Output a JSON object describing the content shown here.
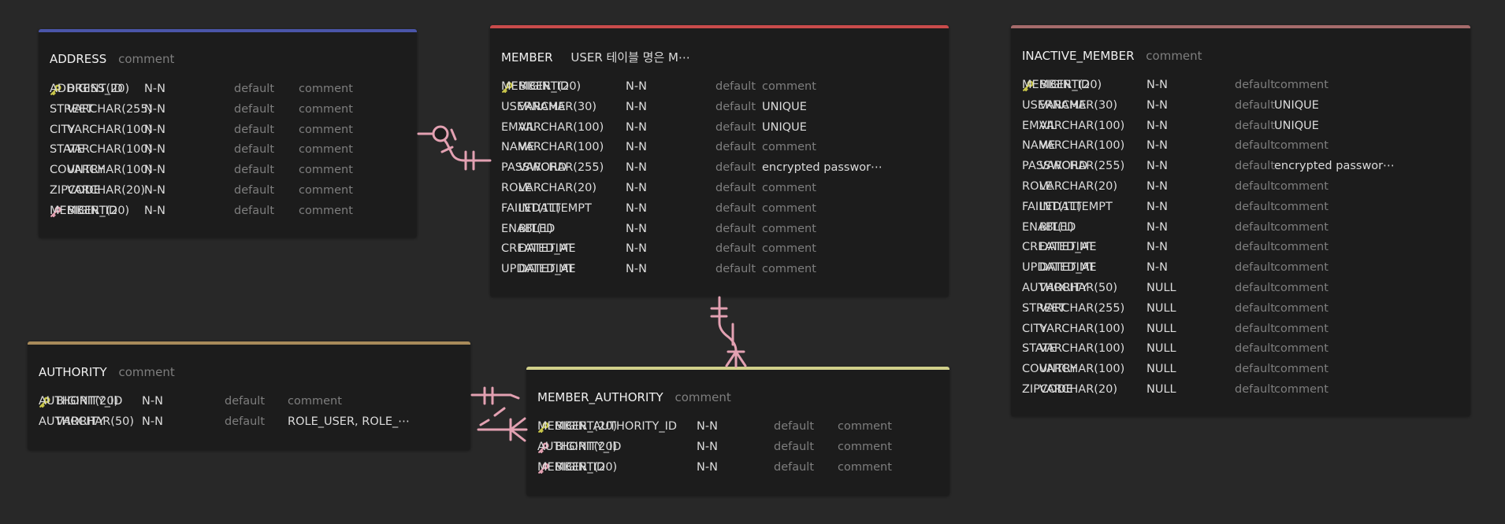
{
  "colors": {
    "background": "#282828",
    "table_bg": "#1c1c1c",
    "relationship": "#e3a1b2",
    "primary_key": "#c9c64a",
    "foreign_key": "#e3a1b2",
    "muted_text": "#7e7e7e"
  },
  "tables": {
    "address": {
      "name": "ADDRESS",
      "comment": "comment",
      "color": "#4a55a8",
      "columns": [
        {
          "name": "ADDRESS_ID",
          "type": "BIGINT(20)",
          "nullable": "N-N",
          "default": "default",
          "comment": "comment",
          "key": "key-icon"
        },
        {
          "name": "STREET",
          "type": "VARCHAR(255)",
          "nullable": "N-N",
          "default": "default",
          "comment": "comment"
        },
        {
          "name": "CITY",
          "type": "VARCHAR(100)",
          "nullable": "N-N",
          "default": "default",
          "comment": "comment"
        },
        {
          "name": "STATE",
          "type": "VARCHAR(100)",
          "nullable": "N-N",
          "default": "default",
          "comment": "comment"
        },
        {
          "name": "COUNTRY",
          "type": "VARCHAR(100)",
          "nullable": "N-N",
          "default": "default",
          "comment": "comment"
        },
        {
          "name": "ZIPCODE",
          "type": "VARCHAR(20)",
          "nullable": "N-N",
          "default": "default",
          "comment": "comment"
        },
        {
          "name": "MEMBER_ID",
          "type": "BIGINT(20)",
          "nullable": "N-N",
          "default": "default",
          "comment": "comment",
          "key": "foreign-key-icon"
        }
      ]
    },
    "member": {
      "name": "MEMBER",
      "comment": "USER 테이블 명은 M⋯",
      "color": "#c94b4b",
      "columns": [
        {
          "name": "MEMBER_ID",
          "type": "BIGINT(20)",
          "nullable": "N-N",
          "default": "default",
          "comment": "comment",
          "key": "key-icon"
        },
        {
          "name": "USERNAME",
          "type": "VARCHAR(30)",
          "nullable": "N-N",
          "default": "default",
          "comment": "UNIQUE"
        },
        {
          "name": "EMAIL",
          "type": "VARCHAR(100)",
          "nullable": "N-N",
          "default": "default",
          "comment": "UNIQUE"
        },
        {
          "name": "NAME",
          "type": "VARCHAR(100)",
          "nullable": "N-N",
          "default": "default",
          "comment": "comment"
        },
        {
          "name": "PASSWORD",
          "type": "VARCHAR(255)",
          "nullable": "N-N",
          "default": "default",
          "comment": "encrypted passwor⋯"
        },
        {
          "name": "ROLE",
          "type": "VARCHAR(20)",
          "nullable": "N-N",
          "default": "default",
          "comment": "comment"
        },
        {
          "name": "FAILEDATTEMPT",
          "type": "INT(11)",
          "nullable": "N-N",
          "default": "default",
          "comment": "comment"
        },
        {
          "name": "ENABLED",
          "type": "BIT(1)",
          "nullable": "N-N",
          "default": "default",
          "comment": "comment"
        },
        {
          "name": "CREATED_AT",
          "type": "DATETIME",
          "nullable": "N-N",
          "default": "default",
          "comment": "comment"
        },
        {
          "name": "UPDATED_AT",
          "type": "DATETIME",
          "nullable": "N-N",
          "default": "default",
          "comment": "comment"
        }
      ]
    },
    "inactive_member": {
      "name": "INACTIVE_MEMBER",
      "comment": "comment",
      "color": "#a56b6b",
      "columns": [
        {
          "name": "MEMBER_ID",
          "type": "BIGINT(20)",
          "nullable": "N-N",
          "default": "default",
          "comment": "comment",
          "key": "key-icon"
        },
        {
          "name": "USERNAME",
          "type": "VARCHAR(30)",
          "nullable": "N-N",
          "default": "default",
          "comment": "UNIQUE"
        },
        {
          "name": "EMAIL",
          "type": "VARCHAR(100)",
          "nullable": "N-N",
          "default": "default",
          "comment": "UNIQUE"
        },
        {
          "name": "NAME",
          "type": "VARCHAR(100)",
          "nullable": "N-N",
          "default": "default",
          "comment": "comment"
        },
        {
          "name": "PASSWORD",
          "type": "VARCHAR(255)",
          "nullable": "N-N",
          "default": "default",
          "comment": "encrypted passwor⋯"
        },
        {
          "name": "ROLE",
          "type": "VARCHAR(20)",
          "nullable": "N-N",
          "default": "default",
          "comment": "comment"
        },
        {
          "name": "FAILEDATTEMPT",
          "type": "INT(11)",
          "nullable": "N-N",
          "default": "default",
          "comment": "comment"
        },
        {
          "name": "ENABLED",
          "type": "BIT(1)",
          "nullable": "N-N",
          "default": "default",
          "comment": "comment"
        },
        {
          "name": "CREATED_AT",
          "type": "DATETIME",
          "nullable": "N-N",
          "default": "default",
          "comment": "comment"
        },
        {
          "name": "UPDATED_AT",
          "type": "DATETIME",
          "nullable": "N-N",
          "default": "default",
          "comment": "comment"
        },
        {
          "name": "AUTHORITY",
          "type": "VARCHAR(50)",
          "nullable": "NULL",
          "default": "default",
          "comment": "comment"
        },
        {
          "name": "STREET",
          "type": "VARCHAR(255)",
          "nullable": "NULL",
          "default": "default",
          "comment": "comment"
        },
        {
          "name": "CITY",
          "type": "VARCHAR(100)",
          "nullable": "NULL",
          "default": "default",
          "comment": "comment"
        },
        {
          "name": "STATE",
          "type": "VARCHAR(100)",
          "nullable": "NULL",
          "default": "default",
          "comment": "comment"
        },
        {
          "name": "COUNTRY",
          "type": "VARCHAR(100)",
          "nullable": "NULL",
          "default": "default",
          "comment": "comment"
        },
        {
          "name": "ZIPCODE",
          "type": "VARCHAR(20)",
          "nullable": "NULL",
          "default": "default",
          "comment": "comment"
        }
      ]
    },
    "authority": {
      "name": "AUTHORITY",
      "comment": "comment",
      "color": "#a88a5a",
      "columns": [
        {
          "name": "AUTHORITY_ID",
          "type": "BIGINT(20)",
          "nullable": "N-N",
          "default": "default",
          "comment": "comment",
          "key": "key-icon"
        },
        {
          "name": "AUTHORITY",
          "type": "VARCHAR(50)",
          "nullable": "N-N",
          "default": "default",
          "comment": "ROLE_USER, ROLE_⋯"
        }
      ]
    },
    "member_authority": {
      "name": "MEMBER_AUTHORITY",
      "comment": "comment",
      "color": "#d1d08a",
      "columns": [
        {
          "name": "MEMBER_AUTHORITY_ID",
          "type": "BIGINT(20)",
          "nullable": "N-N",
          "default": "default",
          "comment": "comment",
          "key": "key-icon"
        },
        {
          "name": "AUTHORITY_ID",
          "type": "BIGINT(20)",
          "nullable": "N-N",
          "default": "default",
          "comment": "comment",
          "key": "foreign-key-icon"
        },
        {
          "name": "MEMBER_ID",
          "type": "BIGINT(20)",
          "nullable": "N-N",
          "default": "default",
          "comment": "comment",
          "key": "foreign-key-icon"
        }
      ]
    }
  }
}
